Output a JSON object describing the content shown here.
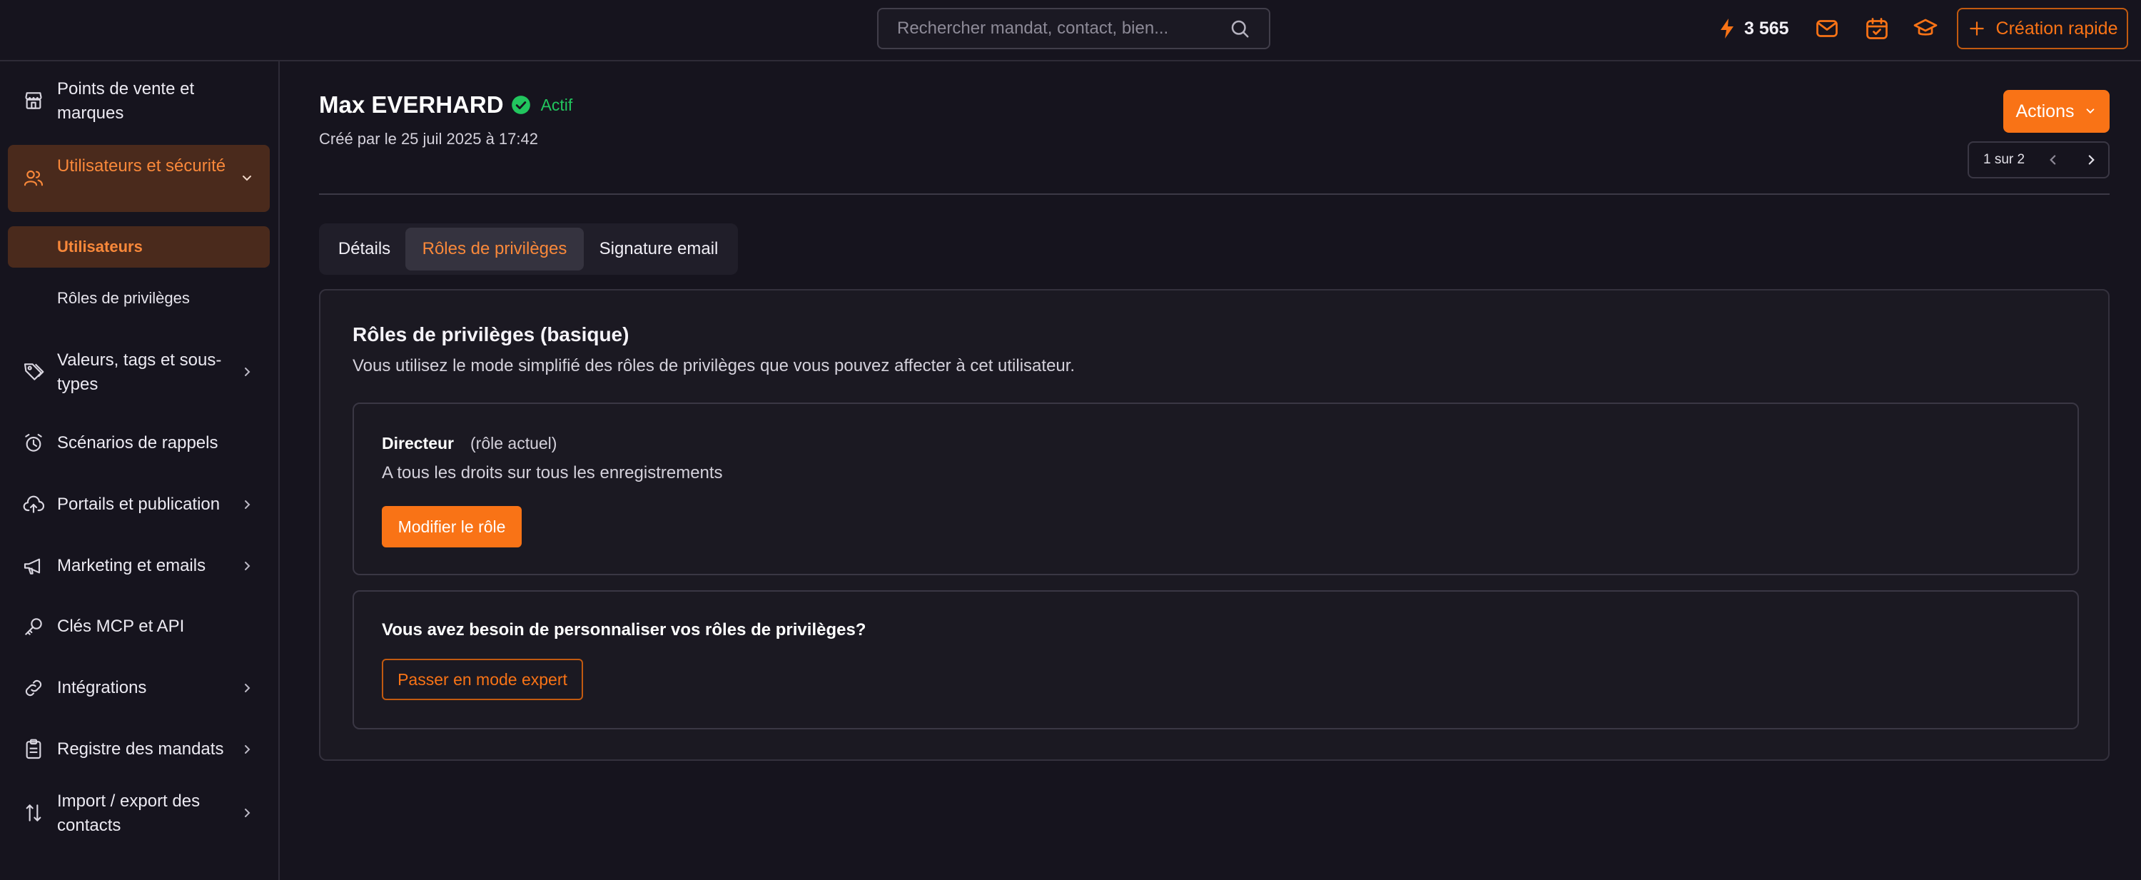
{
  "topbar": {
    "search_placeholder": "Rechercher mandat, contact, bien...",
    "credits": "3 565",
    "quick_create_label": "Création rapide"
  },
  "sidebar": {
    "items": [
      {
        "label": "Points de vente et marques",
        "icon": "store-icon"
      },
      {
        "label": "Utilisateurs et sécurité",
        "icon": "users-icon",
        "active": true,
        "expanded": true
      },
      {
        "label": "Valeurs, tags et sous-types",
        "icon": "tags-icon"
      },
      {
        "label": "Scénarios de rappels",
        "icon": "alarm-clock-icon"
      },
      {
        "label": "Portails et publication",
        "icon": "cloud-upload-icon"
      },
      {
        "label": "Marketing et emails",
        "icon": "megaphone-icon"
      },
      {
        "label": "Clés MCP et API",
        "icon": "key-icon"
      },
      {
        "label": "Intégrations",
        "icon": "link-icon"
      },
      {
        "label": "Registre des mandats",
        "icon": "clipboard-icon"
      },
      {
        "label": "Import / export des contacts",
        "icon": "import-export-icon"
      }
    ],
    "subitems": [
      {
        "label": "Utilisateurs",
        "active": true
      },
      {
        "label": "Rôles de privilèges"
      }
    ]
  },
  "header": {
    "name": "Max EVERHARD",
    "status": "Actif",
    "created": "Créé par le 25 juil 2025 à 17:42",
    "actions_label": "Actions",
    "pager": "1 sur 2"
  },
  "tabs": [
    {
      "label": "Détails"
    },
    {
      "label": "Rôles de privilèges",
      "active": true
    },
    {
      "label": "Signature email"
    }
  ],
  "card": {
    "title": "Rôles de privilèges (basique)",
    "description": "Vous utilisez le mode simplifié des rôles de privilèges que vous pouvez affecter à cet utilisateur.",
    "role": {
      "name": "Directeur",
      "current": "(rôle actuel)",
      "description": "A tous les droits sur tous les enregistrements",
      "button": "Modifier le rôle"
    },
    "expert": {
      "question": "Vous avez besoin de personnaliser vos rôles de privilèges?",
      "button": "Passer en mode expert"
    }
  },
  "colors": {
    "accent": "#f97316",
    "background": "#16141e",
    "active_bg": "#4a2a1c",
    "success": "#22c55e"
  }
}
